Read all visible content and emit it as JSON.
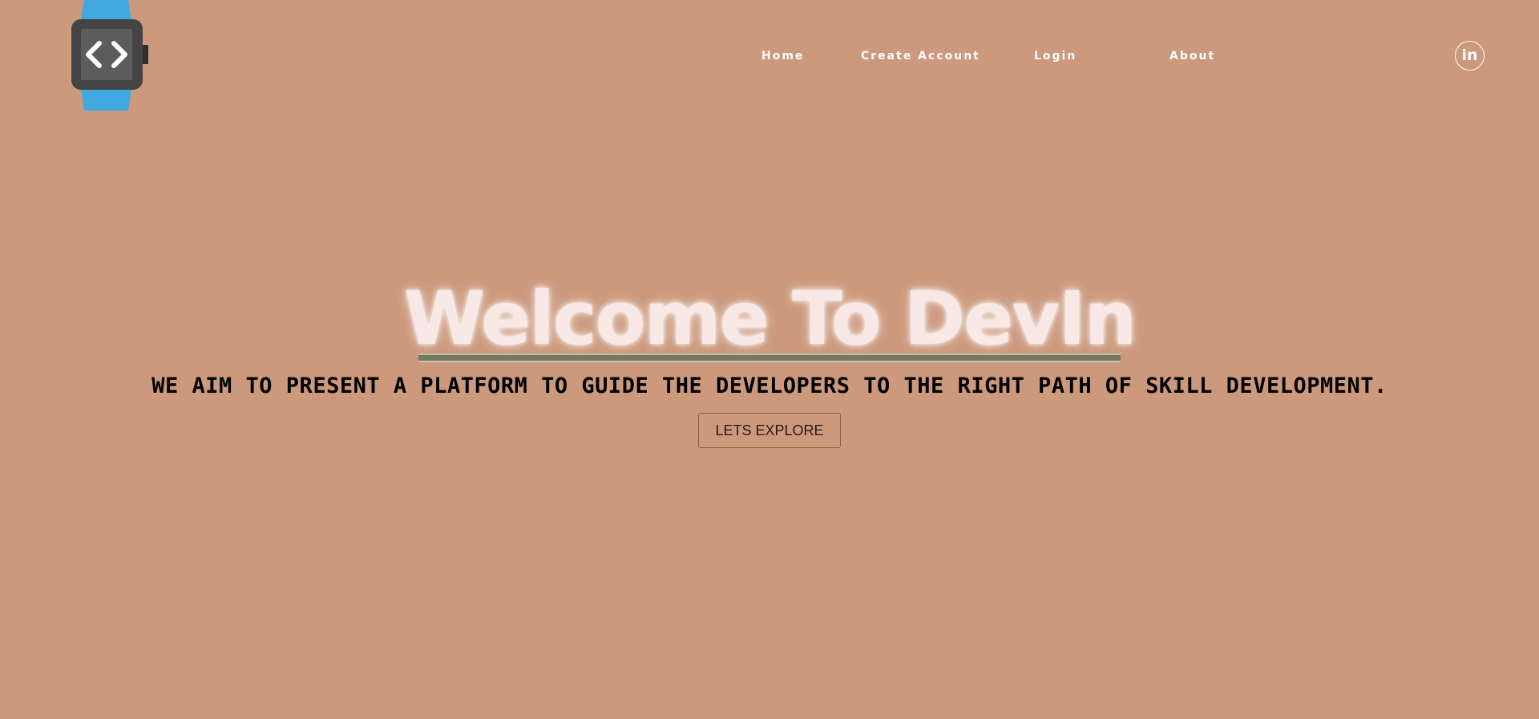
{
  "brand": {
    "logo_icon": "smartwatch-code-icon",
    "colors": {
      "background": "#cc997d",
      "watch_band": "#42a9e0",
      "watch_body": "#444444",
      "hero_title": "#f8e9e6",
      "underline": "#77795f"
    }
  },
  "nav": {
    "items": [
      {
        "label": "Home"
      },
      {
        "label": "Create Account"
      },
      {
        "label": "Login"
      },
      {
        "label": "About"
      }
    ],
    "social": {
      "label": "in",
      "icon": "linkedin-icon"
    }
  },
  "hero": {
    "title": "Welcome To DevIn",
    "subtitle": "WE AIM TO PRESENT A PLATFORM TO GUIDE THE DEVELOPERS TO THE RIGHT PATH OF SKILL DEVELOPMENT.",
    "cta_label": "LETS EXPLORE"
  }
}
